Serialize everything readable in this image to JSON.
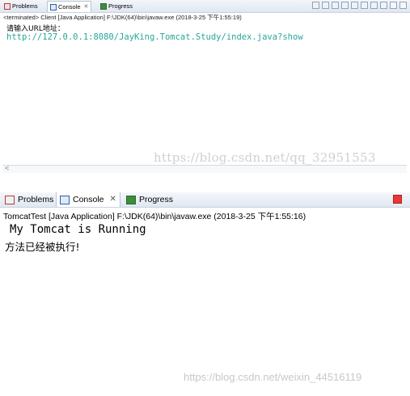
{
  "top_view": {
    "tabs": [
      {
        "label": "Problems",
        "icon": "problems-icon",
        "active": false
      },
      {
        "label": "Console",
        "icon": "console-icon",
        "active": true
      },
      {
        "label": "Progress",
        "icon": "progress-icon",
        "active": false
      }
    ],
    "status": "<terminated> Client [Java Application] F:\\JDK(64)\\bin\\javaw.exe (2018-3-25 下午1:55:19)",
    "output_line1": "请输入URL地址：",
    "output_line2": "http://127.0.0.1:8080/JayKing.Tomcat.Study/index.java?show",
    "link_color": "#26a69a",
    "scroll_arrow": "<"
  },
  "bottom_view": {
    "tabs": [
      {
        "label": "Problems",
        "icon": "problems-icon",
        "active": false
      },
      {
        "label": "Console",
        "icon": "console-icon",
        "active": true
      },
      {
        "label": "Progress",
        "icon": "progress-icon",
        "active": false
      }
    ],
    "status": "TomcatTest [Java Application] F:\\JDK(64)\\bin\\javaw.exe (2018-3-25 下午1:55:16)",
    "output_line1": "My Tomcat is Running",
    "output_line2": "方法已经被执行!",
    "terminate_color": "#e53935"
  },
  "watermarks": {
    "top": "https://blog.csdn.net/qq_32951553",
    "bottom": "https://blog.csdn.net/weixin_44516119"
  }
}
